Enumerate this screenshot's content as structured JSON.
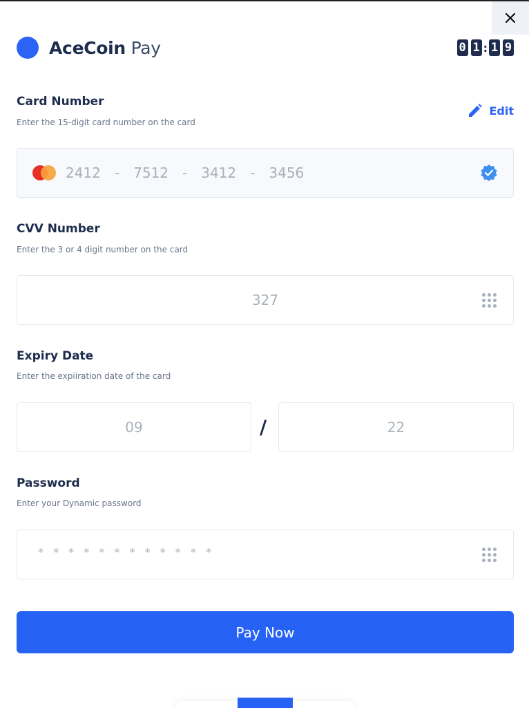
{
  "brand": {
    "name_bold": "AceCoin",
    "name_light": "Pay",
    "color": "#2b63f5"
  },
  "timer": {
    "digits": [
      "0",
      "1",
      "1",
      "9"
    ],
    "separator": ":"
  },
  "card_number": {
    "title": "Card Number",
    "subtitle": "Enter the 15-digit card number on the card",
    "edit_label": "Edit",
    "groups": [
      "2412",
      "7512",
      "3412",
      "3456"
    ],
    "separator": "-",
    "brand_icon": "mastercard-icon",
    "verified_icon": "verified-badge-icon"
  },
  "cvv": {
    "title": "CVV Number",
    "subtitle": "Enter the 3 or 4 digit number on the card",
    "value": "327"
  },
  "expiry": {
    "title": "Expiry Date",
    "subtitle": "Enter the expiiration date of the card",
    "month": "09",
    "separator": "/",
    "year": "22"
  },
  "password": {
    "title": "Password",
    "subtitle": "Enter your Dynamic password",
    "placeholder": "* * * * * * * * * * * *"
  },
  "pay_button": {
    "label": "Pay Now"
  },
  "colors": {
    "accent": "#2663f5",
    "heading": "#1e2d4d",
    "muted": "#a9b0bc"
  }
}
